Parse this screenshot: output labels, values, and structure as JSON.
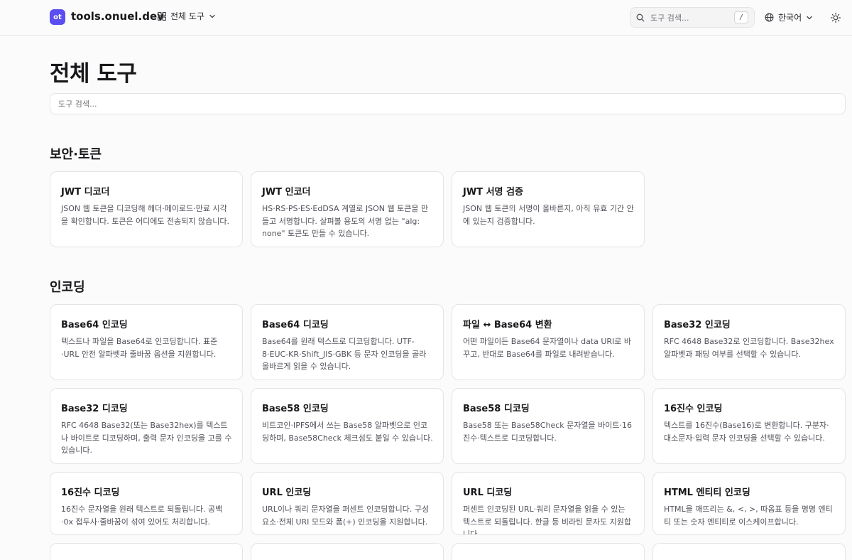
{
  "header": {
    "logo_text": "ot",
    "site_name": "tools.onuel.dev",
    "nav_all_label": "전체 도구",
    "search_placeholder": "도구 검색...",
    "search_shortcut": "/",
    "language_label": "한국어"
  },
  "main": {
    "title": "전체 도구",
    "filter_placeholder": "도구 검색..."
  },
  "sections": [
    {
      "title": "보안·토큰",
      "cards": [
        {
          "title": "JWT 디코더",
          "desc": "JSON 웹 토큰을 디코딩해 헤더·페이로드·만료 시각을 확인합니다. 토큰은 어디에도 전송되지 않습니다."
        },
        {
          "title": "JWT 인코더",
          "desc": "HS·RS·PS·ES·EdDSA 계열로 JSON 웹 토큰을 만들고 서명합니다. 살펴볼 용도의 서명 없는 \"alg: none\" 토큰도 만들 수 있습니다."
        },
        {
          "title": "JWT 서명 검증",
          "desc": "JSON 웹 토큰의 서명이 올바른지, 아직 유효 기간 안에 있는지 검증합니다."
        }
      ]
    },
    {
      "title": "인코딩",
      "cards": [
        {
          "title": "Base64 인코딩",
          "desc": "텍스트나 파일을 Base64로 인코딩합니다. 표준·URL 안전 알파벳과 줄바꿈 옵션을 지원합니다."
        },
        {
          "title": "Base64 디코딩",
          "desc": "Base64를 원래 텍스트로 디코딩합니다. UTF-8·EUC-KR·Shift_JIS·GBK 등 문자 인코딩을 골라 올바르게 읽을 수 있습니다."
        },
        {
          "title": "파일 ↔ Base64 변환",
          "desc": "어떤 파일이든 Base64 문자열이나 data URI로 바꾸고, 반대로 Base64를 파일로 내려받습니다."
        },
        {
          "title": "Base32 인코딩",
          "desc": "RFC 4648 Base32로 인코딩합니다. Base32hex 알파벳과 패딩 여부를 선택할 수 있습니다."
        },
        {
          "title": "Base32 디코딩",
          "desc": "RFC 4648 Base32(또는 Base32hex)를 텍스트나 바이트로 디코딩하며, 출력 문자 인코딩을 고를 수 있습니다."
        },
        {
          "title": "Base58 인코딩",
          "desc": "비트코인·IPFS에서 쓰는 Base58 알파벳으로 인코딩하며, Base58Check 체크섬도 붙일 수 있습니다."
        },
        {
          "title": "Base58 디코딩",
          "desc": "Base58 또는 Base58Check 문자열을 바이트·16진수·텍스트로 디코딩합니다."
        },
        {
          "title": "16진수 인코딩",
          "desc": "텍스트를 16진수(Base16)로 변환합니다. 구분자·대소문자·입력 문자 인코딩을 선택할 수 있습니다."
        },
        {
          "title": "16진수 디코딩",
          "desc": "16진수 문자열을 원래 텍스트로 되돌립니다. 공백·0x 접두사·줄바꿈이 섞여 있어도 처리합니다."
        },
        {
          "title": "URL 인코딩",
          "desc": "URL이나 쿼리 문자열을 퍼센트 인코딩합니다. 구성요소·전체 URI 모드와 폼(+) 인코딩을 지원합니다."
        },
        {
          "title": "URL 디코딩",
          "desc": "퍼센트 인코딩된 URL·쿼리 문자열을 읽을 수 있는 텍스트로 되돌립니다. 한글 등 비라틴 문자도 지원합니다."
        },
        {
          "title": "HTML 엔티티 인코딩",
          "desc": "HTML을 깨뜨리는 &, <, >, 따옴표 등을 명명 엔티티 또는 숫자 엔티티로 이스케이프합니다."
        }
      ]
    }
  ]
}
